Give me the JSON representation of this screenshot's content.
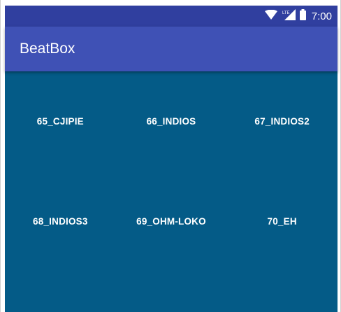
{
  "status_bar": {
    "time": "7:00",
    "icons": [
      "wifi-icon",
      "lte-signal-icon",
      "battery-icon"
    ],
    "lte_label": "LTE"
  },
  "app_bar": {
    "title": "BeatBox",
    "color": "#3F51B5",
    "status_color": "#303F9F"
  },
  "content": {
    "background": "#045B87",
    "sounds": [
      {
        "label": "65_CJIPIE"
      },
      {
        "label": "66_INDIOS"
      },
      {
        "label": "67_INDIOS2"
      },
      {
        "label": "68_INDIOS3"
      },
      {
        "label": "69_OHM-LOKO"
      },
      {
        "label": "70_EH"
      }
    ]
  }
}
